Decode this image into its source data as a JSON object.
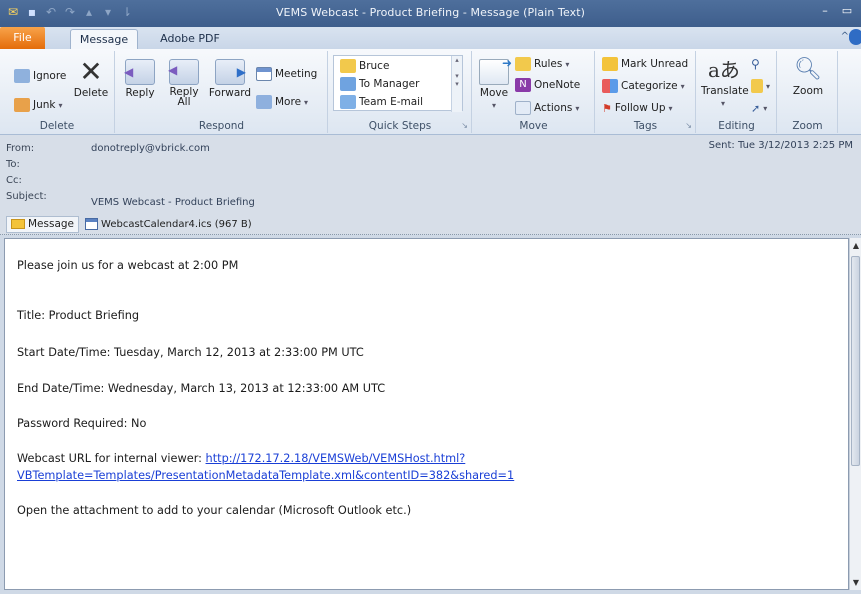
{
  "window": {
    "title": "VEMS Webcast - Product Briefing  -  Message (Plain Text)"
  },
  "tabs": [
    {
      "label": "File"
    },
    {
      "label": "Message"
    },
    {
      "label": "Adobe PDF"
    }
  ],
  "ribbon": {
    "delete_group": {
      "label": "Delete",
      "ignore": "Ignore",
      "junk": "Junk",
      "delete": "Delete"
    },
    "respond_group": {
      "label": "Respond",
      "reply": "Reply",
      "reply_all_1": "Reply",
      "reply_all_2": "All",
      "forward": "Forward",
      "meeting": "Meeting",
      "more": "More"
    },
    "quick_steps": {
      "label": "Quick Steps",
      "items": [
        "Bruce",
        "To Manager",
        "Team E-mail"
      ]
    },
    "move_group": {
      "label": "Move",
      "move": "Move",
      "rules": "Rules",
      "onenote": "OneNote",
      "actions": "Actions"
    },
    "tags_group": {
      "label": "Tags",
      "mark_unread": "Mark Unread",
      "categorize": "Categorize",
      "follow_up": "Follow Up"
    },
    "editing_group": {
      "label": "Editing",
      "translate": "Translate"
    },
    "zoom_group": {
      "label": "Zoom",
      "zoom": "Zoom"
    }
  },
  "header": {
    "from_label": "From:",
    "from_value": "donotreply@vbrick.com",
    "to_label": "To:",
    "cc_label": "Cc:",
    "subject_label": "Subject:",
    "subject_value": "VEMS Webcast - Product Briefing",
    "sent_label": "Sent:",
    "sent_value": "Tue 3/12/2013 2:25 PM",
    "message_tab": "Message",
    "attachment": "WebcastCalendar4.ics (967 B)"
  },
  "body": {
    "line1": "Please join us for a webcast at 2:00 PM",
    "title": "Title: Product Briefing",
    "start": "Start Date/Time: Tuesday, March 12, 2013 at 2:33:00 PM UTC",
    "end": "End Date/Time: Wednesday, March 13, 2013 at 12:33:00 AM UTC",
    "password": "Password Required: No",
    "url_label": "Webcast URL for internal viewer: ",
    "url_part1": "http://172.17.2.18/VEMSWeb/VEMSHost.html?",
    "url_part2": "VBTemplate=Templates/PresentationMetadataTemplate.xml&contentID=382&shared=1",
    "closing": "Open the attachment to add to your calendar (Microsoft Outlook etc.)"
  }
}
